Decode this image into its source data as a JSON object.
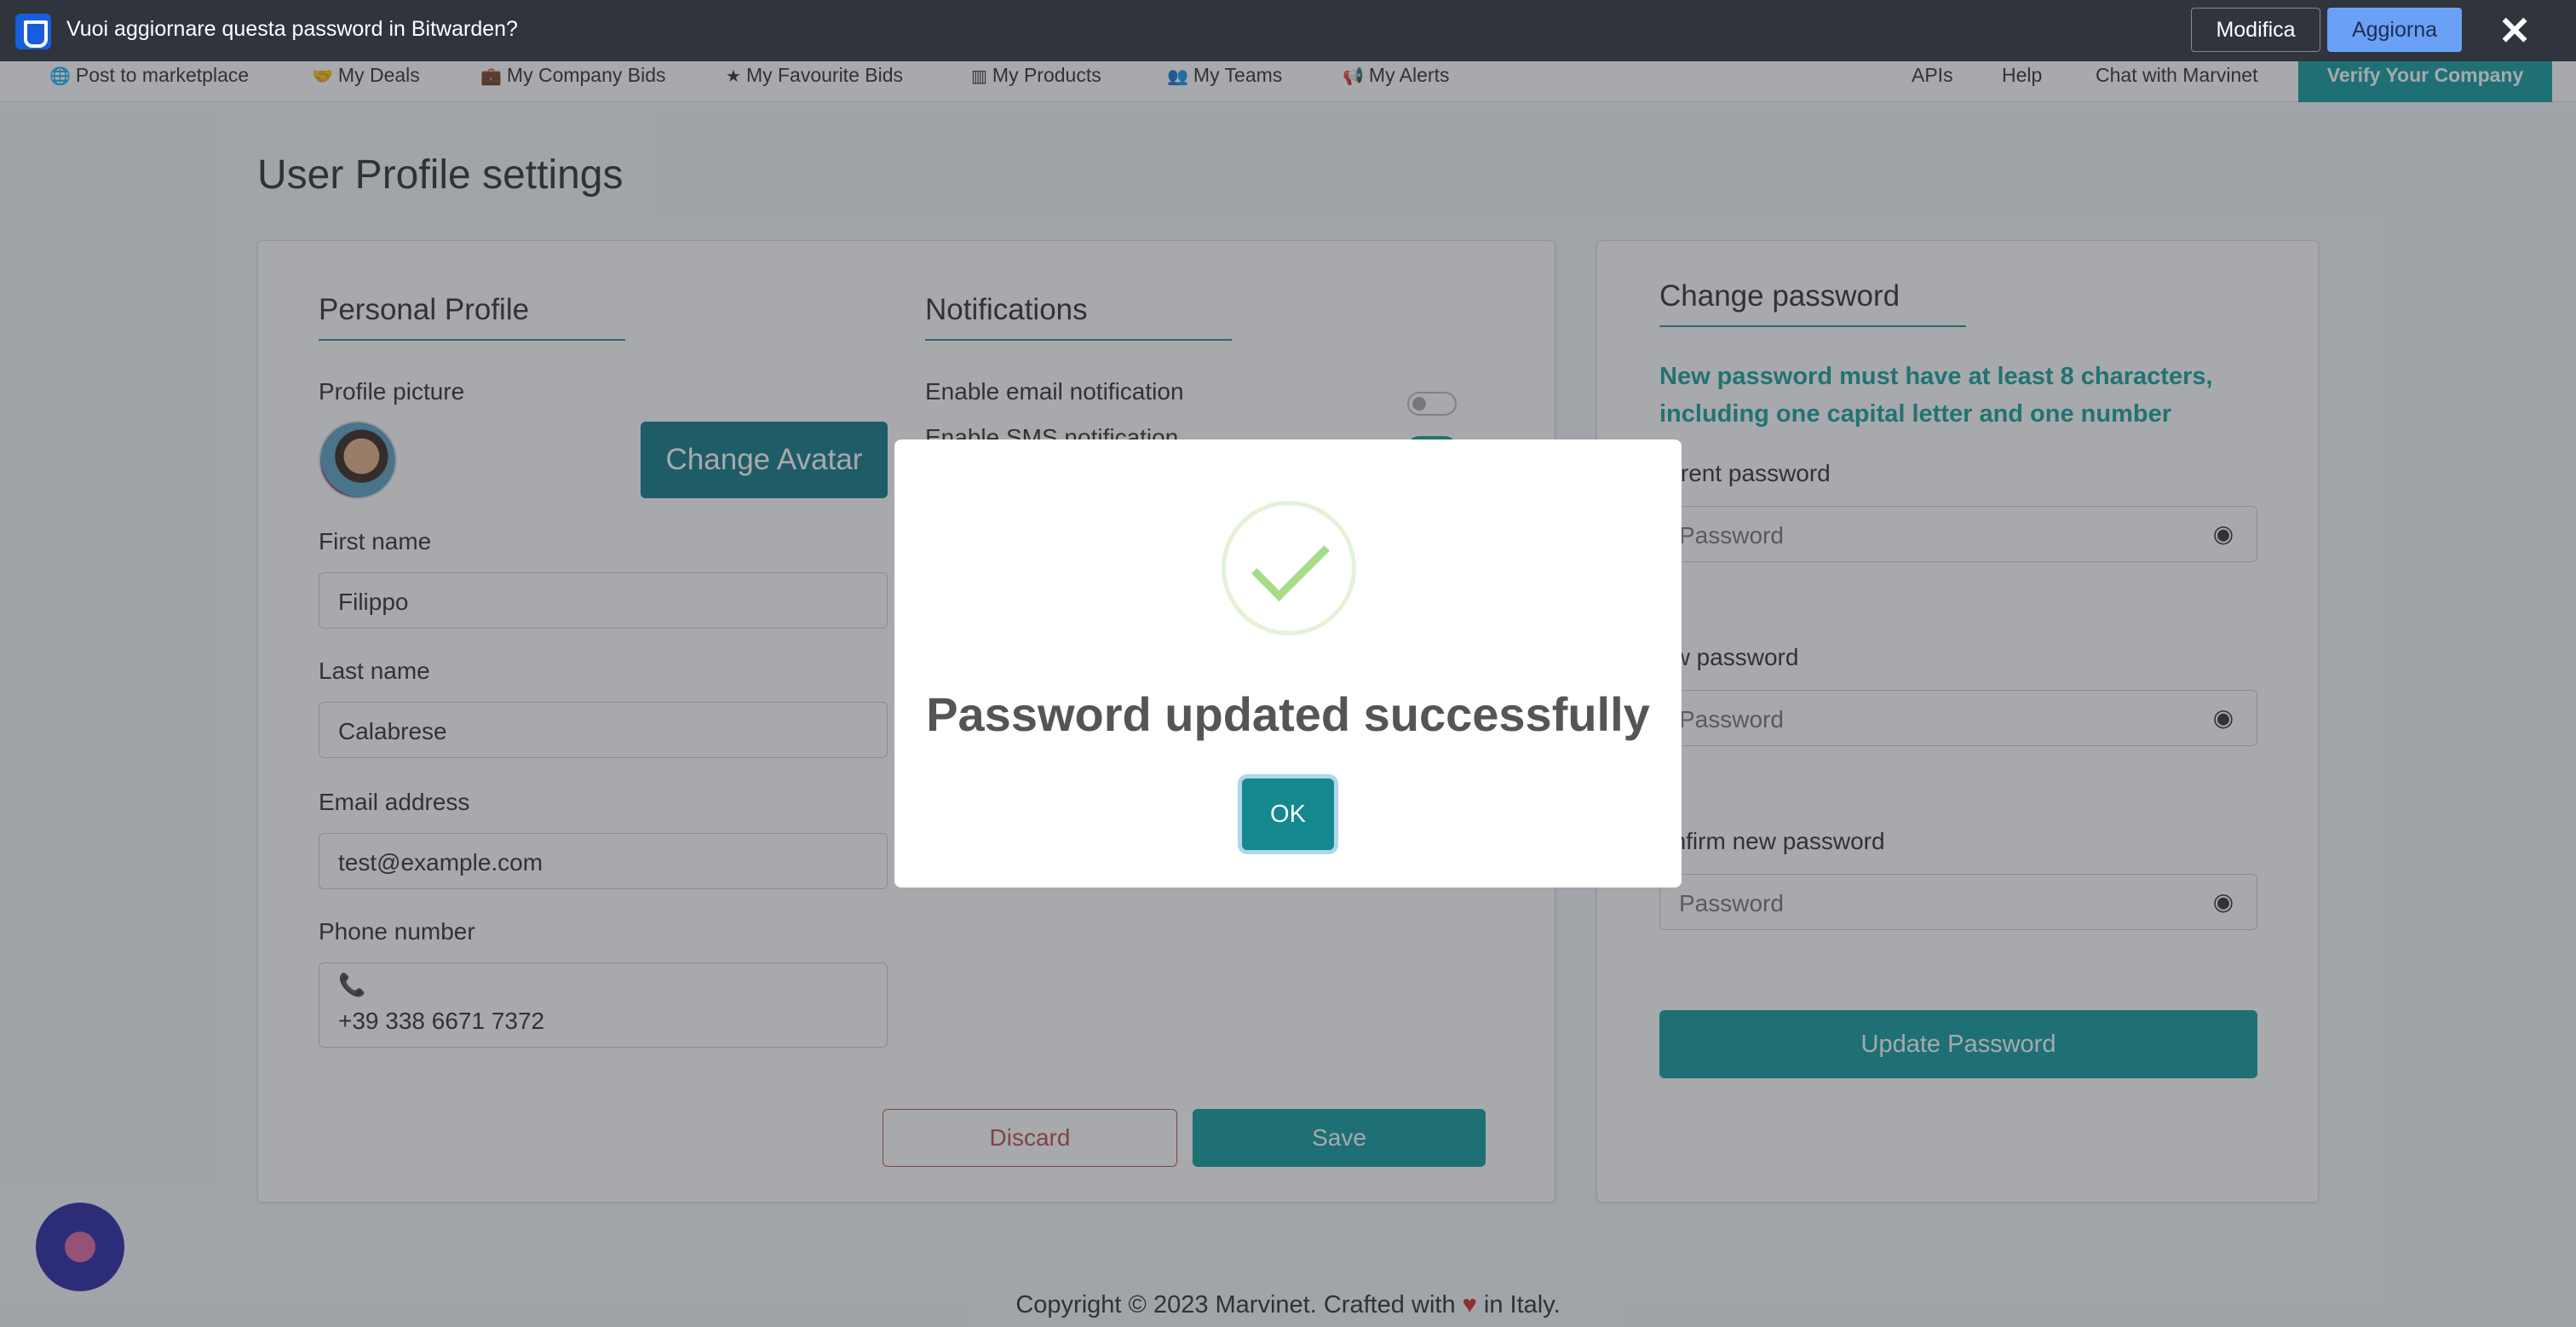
{
  "bitwarden": {
    "message": "Vuoi aggiornare questa password in Bitwarden?",
    "edit_label": "Modifica",
    "update_label": "Aggiorna",
    "close_glyph": "✕"
  },
  "nav": {
    "items": [
      {
        "icon": "globe-icon",
        "glyph": "🌐",
        "label": "Post to marketplace"
      },
      {
        "icon": "handshake-icon",
        "glyph": "🤝",
        "label": "My Deals"
      },
      {
        "icon": "briefcase-icon",
        "glyph": "💼",
        "label": "My Company Bids"
      },
      {
        "icon": "star-icon",
        "glyph": "★",
        "label": "My Favourite Bids"
      },
      {
        "icon": "barcode-icon",
        "glyph": "▥",
        "label": "My Products"
      },
      {
        "icon": "users-icon",
        "glyph": "👥",
        "label": "My Teams"
      },
      {
        "icon": "bullhorn-icon",
        "glyph": "📢",
        "label": "My Alerts"
      }
    ],
    "right": [
      "APIs",
      "Help",
      "Chat with Marvinet"
    ],
    "verify_label": "Verify Your Company"
  },
  "page": {
    "title": "User Profile settings"
  },
  "profile": {
    "heading": "Personal Profile",
    "picture_label": "Profile picture",
    "change_avatar_label": "Change Avatar",
    "first_name_label": "First name",
    "first_name_value": "Filippo",
    "last_name_label": "Last name",
    "last_name_value": "Calabrese",
    "email_label": "Email address",
    "email_value": "test@example.com",
    "phone_label": "Phone number",
    "phone_value": "+39 338 6671 7372",
    "discard_label": "Discard",
    "save_label": "Save"
  },
  "notifications": {
    "heading": "Notifications",
    "email_label": "Enable email notification",
    "sms_label": "Enable SMS notification",
    "email_enabled": false,
    "sms_enabled": true
  },
  "password": {
    "heading": "Change password",
    "hint": "New password must have at least 8 characters, including one capital letter and one number",
    "current_label": "urrent password",
    "new_label": "ew password",
    "confirm_label": "onfirm new password",
    "placeholder": "Password",
    "update_label": "Update Password"
  },
  "footer": {
    "prefix": "Copyright © 2023 Marvinet. Crafted with",
    "suffix": "in Italy."
  },
  "modal": {
    "title": "Password updated successfully",
    "ok_label": "OK"
  }
}
